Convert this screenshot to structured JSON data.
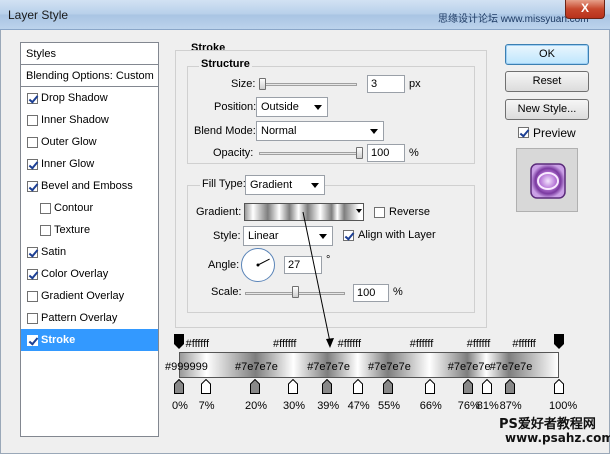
{
  "window": {
    "title": "Layer Style",
    "close_glyph": "X",
    "watermark_top": "思缘设计论坛 www.missyuan.com"
  },
  "styles_list": {
    "header": "Styles",
    "blending_options": "Blending Options: Custom",
    "items": [
      {
        "label": "Drop Shadow",
        "checked": true
      },
      {
        "label": "Inner Shadow",
        "checked": false
      },
      {
        "label": "Outer Glow",
        "checked": false
      },
      {
        "label": "Inner Glow",
        "checked": true
      },
      {
        "label": "Bevel and Emboss",
        "checked": true
      },
      {
        "label": "Contour",
        "checked": false
      },
      {
        "label": "Texture",
        "checked": false
      },
      {
        "label": "Satin",
        "checked": true
      },
      {
        "label": "Color Overlay",
        "checked": true
      },
      {
        "label": "Gradient Overlay",
        "checked": false
      },
      {
        "label": "Pattern Overlay",
        "checked": false
      },
      {
        "label": "Stroke",
        "checked": true,
        "selected": true
      }
    ]
  },
  "stroke": {
    "section_title": "Stroke",
    "structure_title": "Structure",
    "size": {
      "label": "Size:",
      "value": "3",
      "unit": "px",
      "level_fraction": 0.0
    },
    "position": {
      "label": "Position:",
      "value": "Outside"
    },
    "blend_mode": {
      "label": "Blend Mode:",
      "value": "Normal"
    },
    "opacity": {
      "label": "Opacity:",
      "value": "100",
      "unit": "%",
      "level_fraction": 1.0
    },
    "fill_type": {
      "label": "Fill Type:",
      "value": "Gradient"
    },
    "gradient": {
      "label": "Gradient:",
      "reverse_label": "Reverse",
      "reverse_checked": false
    },
    "style": {
      "label": "Style:",
      "value": "Linear",
      "align_label": "Align with Layer",
      "align_checked": true
    },
    "angle": {
      "label": "Angle:",
      "value": "27",
      "unit": "°"
    },
    "scale": {
      "label": "Scale:",
      "value": "100",
      "unit": "%",
      "level_fraction": 0.5
    }
  },
  "buttons": {
    "ok": "OK",
    "reset": "Reset",
    "new_style": "New Style...",
    "preview_label": "Preview",
    "preview_checked": true
  },
  "gradient_annotation": {
    "top_labels": [
      "#ffffff",
      "#ffffff",
      "#ffffff",
      "#ffffff",
      "#ffffff",
      "#ffffff"
    ],
    "bar_labels": [
      "#999999",
      "#7e7e7e",
      "#7e7e7e",
      "#7e7e7e",
      "#7e7e7e",
      "#7e7e7e"
    ],
    "stops": [
      "0%",
      "7%",
      "20%",
      "30%",
      "39%",
      "47%",
      "55%",
      "66%",
      "76%",
      "81%",
      "87%",
      "100%"
    ]
  },
  "watermark_bottom": {
    "line1": "PS爱好者教程网",
    "line2": "www.psahz.com"
  },
  "colors": {
    "selection": "#3399ff",
    "accent": "#5a84b8"
  }
}
